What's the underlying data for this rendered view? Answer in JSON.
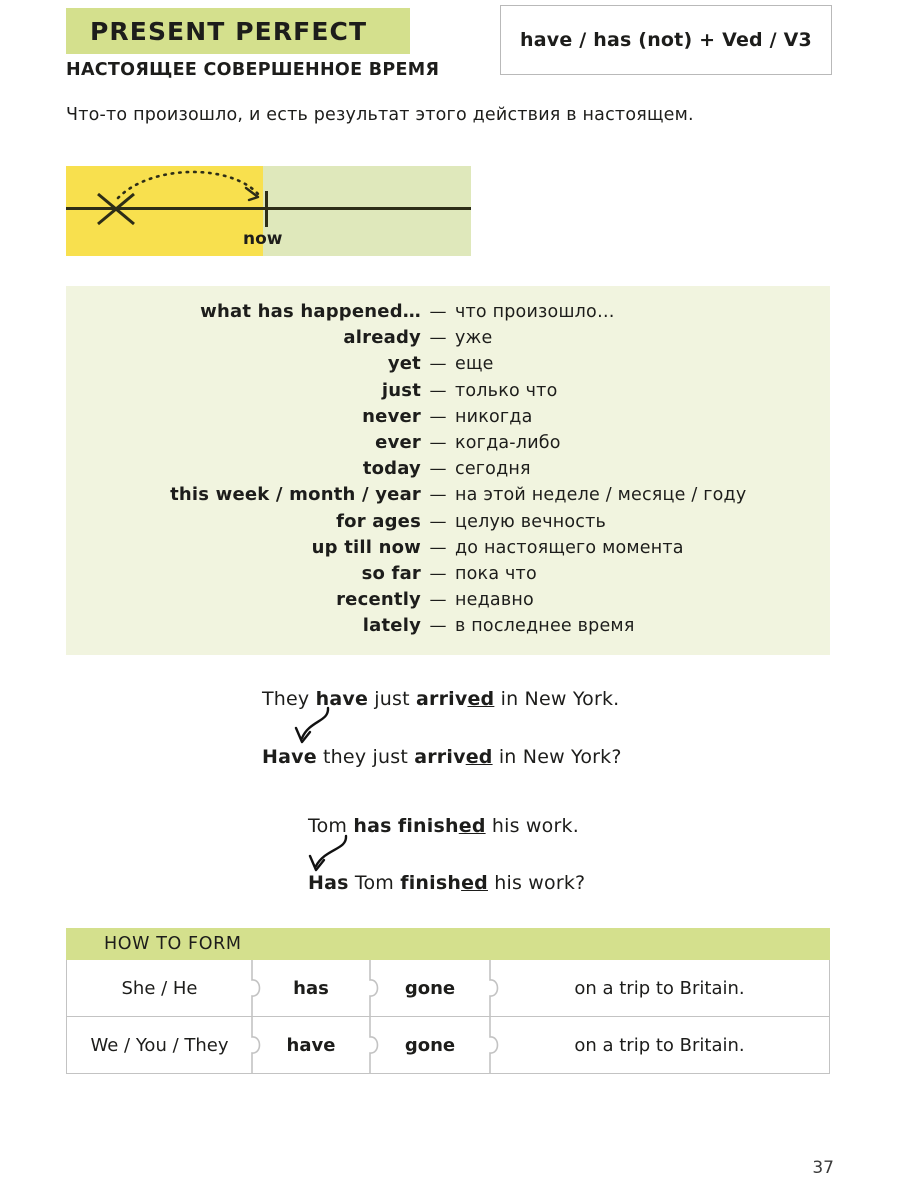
{
  "header": {
    "title": "PRESENT PERFECT",
    "subtitle": "НАСТОЯЩЕЕ СОВЕРШЕННОЕ ВРЕМЯ",
    "formula": "have / has (not) + Ved / V3",
    "intro": "Что-то произошло, и есть результат этого действия в настоящем."
  },
  "timeline": {
    "now_label": "now",
    "past_color": "#f8e04e",
    "future_color": "#dfe8bb"
  },
  "vocabulary": {
    "dash": "—",
    "items": [
      {
        "en": "what has happened…",
        "ru": "что произошло…"
      },
      {
        "en": "already",
        "ru": "уже"
      },
      {
        "en": "yet",
        "ru": "еще"
      },
      {
        "en": "just",
        "ru": "только что"
      },
      {
        "en": "never",
        "ru": "никогда"
      },
      {
        "en": "ever",
        "ru": "когда-либо"
      },
      {
        "en": "today",
        "ru": "сегодня"
      },
      {
        "en": "this week / month / year",
        "ru": "на этой неделе / месяце / году"
      },
      {
        "en": "for ages",
        "ru": "целую вечность"
      },
      {
        "en": "up till now",
        "ru": "до настоящего момента"
      },
      {
        "en": "so far",
        "ru": "пока что"
      },
      {
        "en": "recently",
        "ru": "недавно"
      },
      {
        "en": "lately",
        "ru": "в последнее время"
      }
    ]
  },
  "examples": [
    {
      "statement": {
        "pre": "They ",
        "aux": "have",
        "mid": " just ",
        "verb_stem": "arriv",
        "verb_suffix": "ed",
        "post": " in New York."
      },
      "question": {
        "aux": "Have",
        "pre": " they just ",
        "verb_stem": "arriv",
        "verb_suffix": "ed",
        "post": " in New York?"
      }
    },
    {
      "statement": {
        "pre": "Tom ",
        "aux": "has",
        "mid": " ",
        "verb_stem": "finish",
        "verb_suffix": "ed",
        "post": " his work."
      },
      "question": {
        "aux": "Has",
        "pre": " Tom ",
        "verb_stem": "finish",
        "verb_suffix": "ed",
        "post": " his work?"
      }
    }
  ],
  "form_table": {
    "header": "HOW TO FORM",
    "rows": [
      {
        "subject": "She / He",
        "aux": "has",
        "verb": "gone",
        "rest": "on a trip to Britain."
      },
      {
        "subject": "We / You / They",
        "aux": "have",
        "verb": "gone",
        "rest": "on a trip to Britain."
      }
    ]
  },
  "page_number": "37"
}
